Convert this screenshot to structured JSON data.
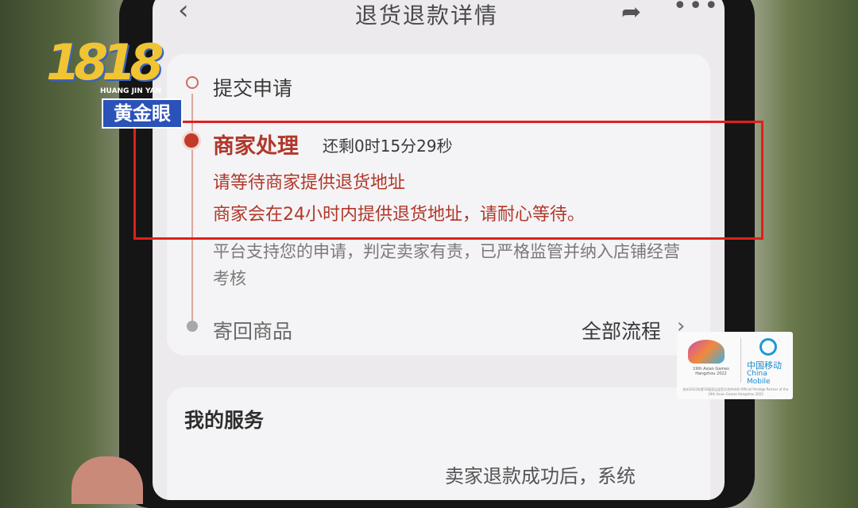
{
  "header": {
    "title": "退货退款详情",
    "back_icon": "chevron-left-icon",
    "share_icon": "share-icon",
    "more_icon": "more-icon"
  },
  "progress": {
    "step1": "提交申请",
    "step2": "商家处理",
    "countdown": "还剩0时15分29秒",
    "sub1": "请等待商家提供退货地址",
    "sub2": "商家会在24小时内提供退货地址，请耐心等待。",
    "note": "平台支持您的申请，判定卖家有责，已严格监管并纳入店铺经营考核",
    "step3": "寄回商品",
    "all_flow": "全部流程"
  },
  "services": {
    "title": "我的服务",
    "cut_text": "卖家退款成功后，系统"
  },
  "overlay": {
    "logo_num": "1818",
    "logo_en": "HUANG JIN YAN",
    "logo_cn": "黄金眼",
    "sponsor_cn": "中国移动",
    "sponsor_en": "China Mobile",
    "sponsor_games": "19th Asian Games Hangzhou 2022",
    "sponsor_foot": "杭州2022年第19届亚运会官方合作伙伴 Official Prestige Partner of the 19th Asian Games Hangzhou 2022"
  },
  "colors": {
    "accent_red": "#b0382a",
    "highlight_box": "#e0201c"
  }
}
